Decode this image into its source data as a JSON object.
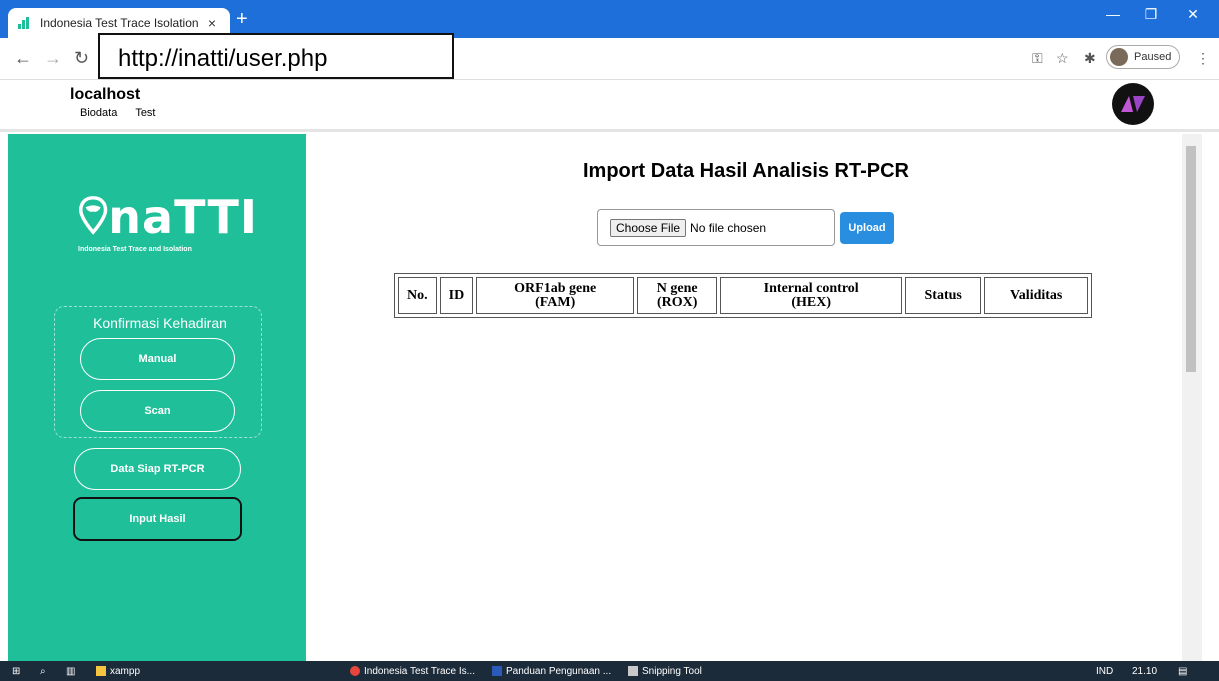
{
  "browser": {
    "tab_title": "Indonesia Test Trace Isolation",
    "tab_close": "×",
    "new_tab": "+",
    "url": "http://inatti/user.php",
    "profile_status": "Paused",
    "window_controls": [
      "—",
      "❐",
      "✕"
    ]
  },
  "header": {
    "site_name": "localhost",
    "links": [
      "Biodata",
      "Test"
    ]
  },
  "sidebar": {
    "brand_name": "naTTI",
    "brand_tagline": "Indonesia Test Trace and Isolation",
    "group_title": "Konfirmasi Kehadiran",
    "group_buttons": [
      "Manual",
      "Scan"
    ],
    "buttons": [
      "Data Siap RT-PCR",
      "Input Hasil"
    ],
    "active_button": "Input Hasil"
  },
  "main": {
    "title": "Import Data Hasil Analisis RT-PCR",
    "file_button": "Choose File",
    "file_status": "No file chosen",
    "upload_label": "Upload",
    "table_headers": [
      [
        "No."
      ],
      [
        "ID"
      ],
      [
        "ORF1ab gene",
        "(FAM)"
      ],
      [
        "N gene",
        "(ROX)"
      ],
      [
        "Internal control",
        "(HEX)"
      ],
      [
        "Status"
      ],
      [
        "Validitas"
      ]
    ]
  },
  "taskbar": {
    "items": [
      "xampp",
      "Indonesia Test Trace Is...",
      "Panduan Pengunaan ...",
      "Snipping Tool"
    ],
    "language": "IND",
    "time": "21.10"
  },
  "colors": {
    "sidebar": "#1fbf9a",
    "titlebar": "#1e6fd9",
    "upload": "#2a8ee0"
  }
}
